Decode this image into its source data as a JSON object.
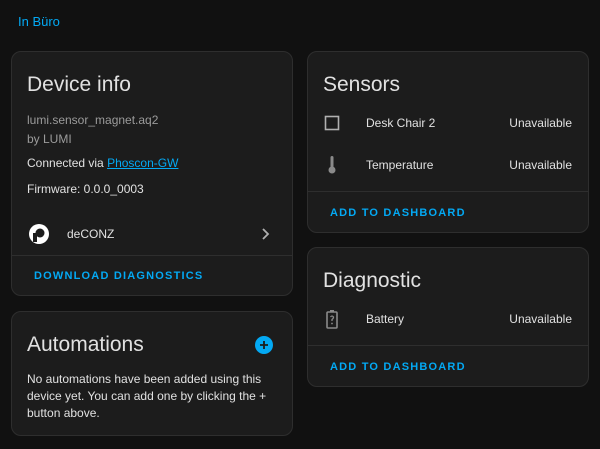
{
  "area_link": "In Büro",
  "device_info": {
    "title": "Device info",
    "model": "lumi.sensor_magnet.aq2",
    "manufacturer": "by LUMI",
    "connected_via_label": "Connected via",
    "connected_via_link": "Phoscon-GW",
    "firmware": "Firmware: 0.0.0_0003",
    "integration": "deCONZ",
    "download_button": "Download diagnostics"
  },
  "automations": {
    "title": "Automations",
    "empty_text": "No automations have been added using this device yet. You can add one by clicking the + button above."
  },
  "sensors": {
    "title": "Sensors",
    "items": [
      {
        "icon": "checkbox-icon",
        "name": "Desk Chair 2",
        "state": "Unavailable"
      },
      {
        "icon": "thermometer-icon",
        "name": "Temperature",
        "state": "Unavailable"
      }
    ],
    "add_button": "Add to dashboard"
  },
  "diagnostic": {
    "title": "Diagnostic",
    "items": [
      {
        "icon": "battery-unknown-icon",
        "name": "Battery",
        "state": "Unavailable"
      }
    ],
    "add_button": "Add to dashboard"
  },
  "colors": {
    "accent": "#03a9f4",
    "background": "#111111",
    "card": "#1c1c1c",
    "text": "#e1e1e1",
    "muted": "#9b9b9b"
  }
}
